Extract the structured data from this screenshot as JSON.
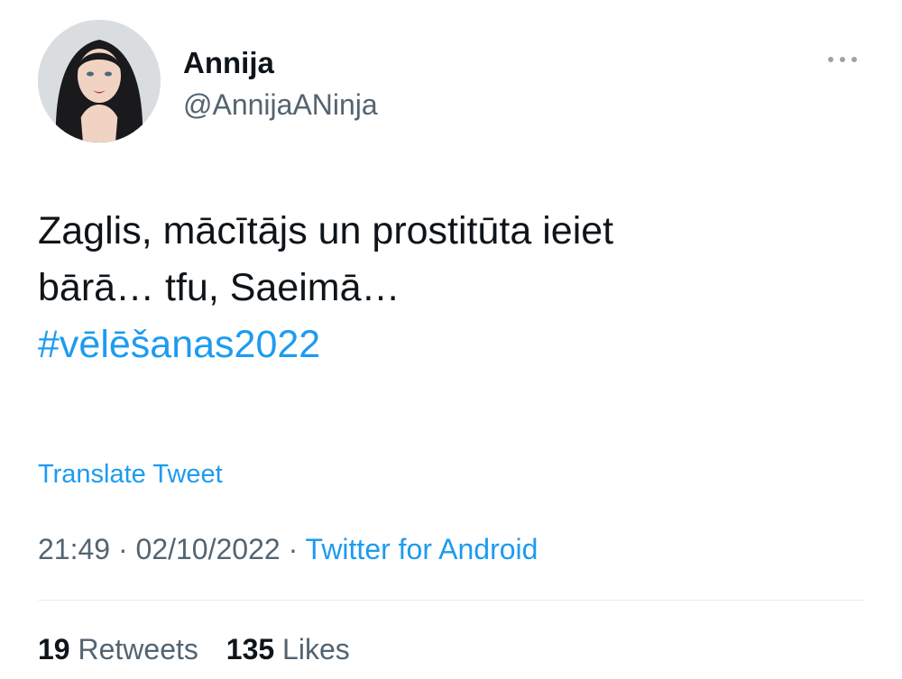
{
  "author": {
    "display_name": "Annija",
    "handle": "@AnnijaANinja"
  },
  "tweet": {
    "line1": "Zaglis, mācītājs un prostitūta ieiet",
    "line2": "bārā… tfu, Saeimā…",
    "hashtag": "#vēlēšanas2022",
    "translate_label": "Translate Tweet",
    "time": "21:49",
    "separator": "·",
    "date": "02/10/2022",
    "source": "Twitter for Android"
  },
  "stats": {
    "retweets_count": "19",
    "retweets_label": "Retweets",
    "likes_count": "135",
    "likes_label": "Likes"
  },
  "icons": {
    "more": "more-horizontal-icon"
  },
  "colors": {
    "accent": "#1d9bf0",
    "text": "#0f1419",
    "secondary": "#536471",
    "divider": "#e6ebee"
  }
}
